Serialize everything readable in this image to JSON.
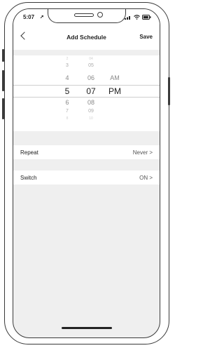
{
  "status_bar": {
    "time": "5:07",
    "location_icon": "arrow-icon"
  },
  "navbar": {
    "title": "Add Schedule",
    "save_label": "Save"
  },
  "picker": {
    "hours": [
      "2",
      "3",
      "4",
      "5",
      "6",
      "7",
      "8"
    ],
    "minutes": [
      "04",
      "05",
      "06",
      "07",
      "08",
      "09",
      "10"
    ],
    "ampm": [
      "AM",
      "PM"
    ],
    "selected": {
      "hour": "5",
      "minute": "07",
      "ampm": "PM"
    }
  },
  "settings": [
    {
      "label": "Repeat",
      "value": "Never >"
    },
    {
      "label": "Switch",
      "value": "ON >"
    }
  ]
}
